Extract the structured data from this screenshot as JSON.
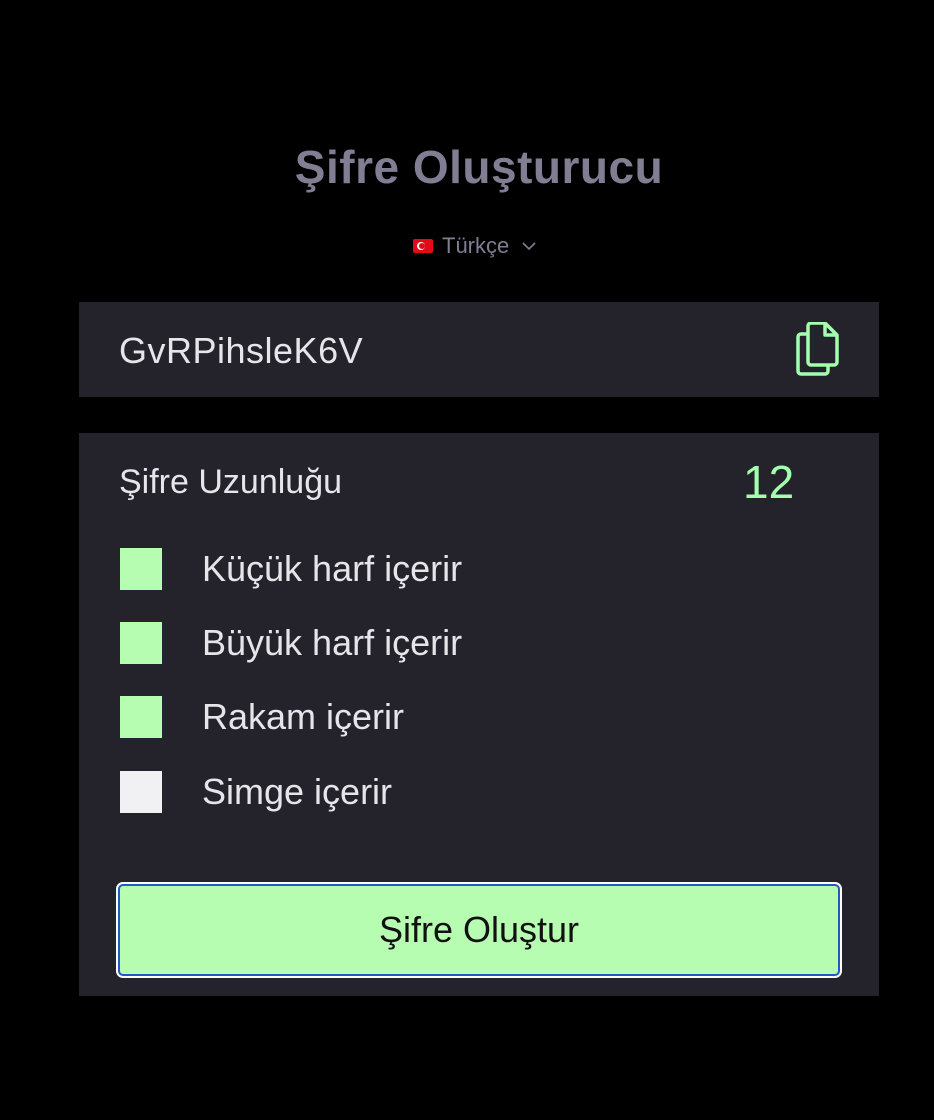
{
  "app": {
    "title": "Şifre Oluşturucu"
  },
  "language": {
    "flag_icon": "turkey-flag-icon",
    "selected": "Türkçe",
    "dropdown_icon": "chevron-down-icon"
  },
  "output": {
    "password": "GvRPihsleK6V",
    "copy_icon": "copy-icon"
  },
  "settings": {
    "length_label": "Şifre Uzunluğu",
    "length_value": "12",
    "options": [
      {
        "label": "Küçük harf içerir",
        "checked": true
      },
      {
        "label": "Büyük harf içerir",
        "checked": true
      },
      {
        "label": "Rakam içerir",
        "checked": true
      },
      {
        "label": "Simge içerir",
        "checked": false
      }
    ],
    "generate_label": "Şifre Oluştur"
  },
  "colors": {
    "background": "#000000",
    "panel": "#24232b",
    "accent_green": "#a4ffaf",
    "checkbox_on": "#b7fdb1",
    "checkbox_off": "#f1f0f3",
    "title_grey": "#817d92",
    "focus_blue": "#2458c2"
  }
}
